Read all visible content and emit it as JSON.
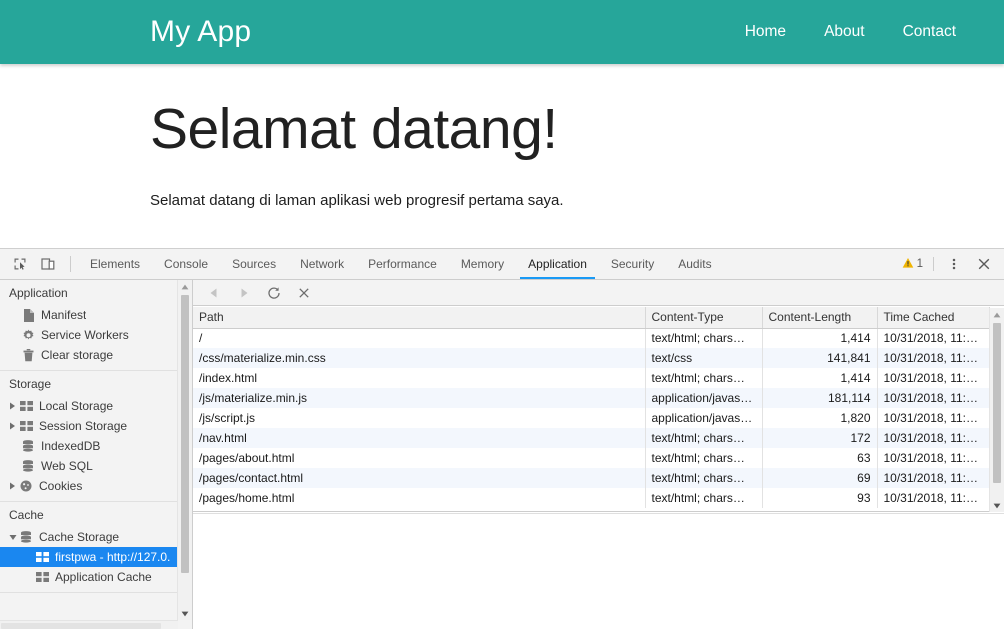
{
  "webpage": {
    "brand": "My App",
    "nav": [
      {
        "label": "Home"
      },
      {
        "label": "About"
      },
      {
        "label": "Contact"
      }
    ],
    "heading": "Selamat datang!",
    "paragraph": "Selamat datang di laman aplikasi web progresif pertama saya.",
    "colors": {
      "brand_teal": "#26a69a",
      "heading_text": "#212121"
    }
  },
  "devtools": {
    "toolbar_icons": [
      {
        "name": "inspect-element-icon"
      },
      {
        "name": "device-toolbar-icon"
      }
    ],
    "tabs": [
      {
        "label": "Elements",
        "selected": false
      },
      {
        "label": "Console",
        "selected": false
      },
      {
        "label": "Sources",
        "selected": false
      },
      {
        "label": "Network",
        "selected": false
      },
      {
        "label": "Performance",
        "selected": false
      },
      {
        "label": "Memory",
        "selected": false
      },
      {
        "label": "Application",
        "selected": true
      },
      {
        "label": "Security",
        "selected": false
      },
      {
        "label": "Audits",
        "selected": false
      }
    ],
    "selected_tab": "Application",
    "warning_count": "1",
    "right_icons": [
      {
        "name": "warning-icon"
      },
      {
        "name": "more-options-icon"
      },
      {
        "name": "close-devtools-icon"
      }
    ],
    "accent_blue": "#1a9af5",
    "selection_blue": "#1a87f0",
    "sidebar": {
      "groups": [
        {
          "title": "Application",
          "items": [
            {
              "label": "Manifest",
              "icon": "document-icon",
              "expandable": false,
              "selected": false
            },
            {
              "label": "Service Workers",
              "icon": "gear-icon",
              "expandable": false,
              "selected": false
            },
            {
              "label": "Clear storage",
              "icon": "trash-icon",
              "expandable": false,
              "selected": false
            }
          ]
        },
        {
          "title": "Storage",
          "items": [
            {
              "label": "Local Storage",
              "icon": "table-icon",
              "expandable": true,
              "expanded": false,
              "selected": false
            },
            {
              "label": "Session Storage",
              "icon": "table-icon",
              "expandable": true,
              "expanded": false,
              "selected": false
            },
            {
              "label": "IndexedDB",
              "icon": "database-icon",
              "expandable": false,
              "selected": false
            },
            {
              "label": "Web SQL",
              "icon": "database-icon",
              "expandable": false,
              "selected": false
            },
            {
              "label": "Cookies",
              "icon": "cookie-icon",
              "expandable": true,
              "expanded": false,
              "selected": false
            }
          ]
        },
        {
          "title": "Cache",
          "items": [
            {
              "label": "Cache Storage",
              "icon": "database-icon",
              "expandable": true,
              "expanded": true,
              "selected": false
            },
            {
              "label": "firstpwa - http://127.0.",
              "icon": "table-icon",
              "expandable": false,
              "selected": true,
              "indent": 2
            },
            {
              "label": "Application Cache",
              "icon": "table-icon",
              "expandable": false,
              "selected": false
            }
          ]
        }
      ]
    },
    "panel": {
      "toolbar_buttons": [
        {
          "name": "back-button",
          "glyph": "prev"
        },
        {
          "name": "forward-button",
          "glyph": "next"
        },
        {
          "name": "refresh-button",
          "glyph": "refresh"
        },
        {
          "name": "delete-button",
          "glyph": "close"
        }
      ],
      "table": {
        "columns": [
          "Path",
          "Content-Type",
          "Content-Length",
          "Time Cached"
        ],
        "rows": [
          {
            "path": "/",
            "content_type": "text/html; chars…",
            "content_length": "1,414",
            "time_cached": "10/31/2018, 11:3…"
          },
          {
            "path": "/css/materialize.min.css",
            "content_type": "text/css",
            "content_length": "141,841",
            "time_cached": "10/31/2018, 11:3…"
          },
          {
            "path": "/index.html",
            "content_type": "text/html; chars…",
            "content_length": "1,414",
            "time_cached": "10/31/2018, 11:3…"
          },
          {
            "path": "/js/materialize.min.js",
            "content_type": "application/javas…",
            "content_length": "181,114",
            "time_cached": "10/31/2018, 11:3…"
          },
          {
            "path": "/js/script.js",
            "content_type": "application/javas…",
            "content_length": "1,820",
            "time_cached": "10/31/2018, 11:3…"
          },
          {
            "path": "/nav.html",
            "content_type": "text/html; chars…",
            "content_length": "172",
            "time_cached": "10/31/2018, 11:3…"
          },
          {
            "path": "/pages/about.html",
            "content_type": "text/html; chars…",
            "content_length": "63",
            "time_cached": "10/31/2018, 11:3…"
          },
          {
            "path": "/pages/contact.html",
            "content_type": "text/html; chars…",
            "content_length": "69",
            "time_cached": "10/31/2018, 11:3…"
          },
          {
            "path": "/pages/home.html",
            "content_type": "text/html; chars…",
            "content_length": "93",
            "time_cached": "10/31/2018, 11:3…"
          }
        ]
      }
    }
  }
}
